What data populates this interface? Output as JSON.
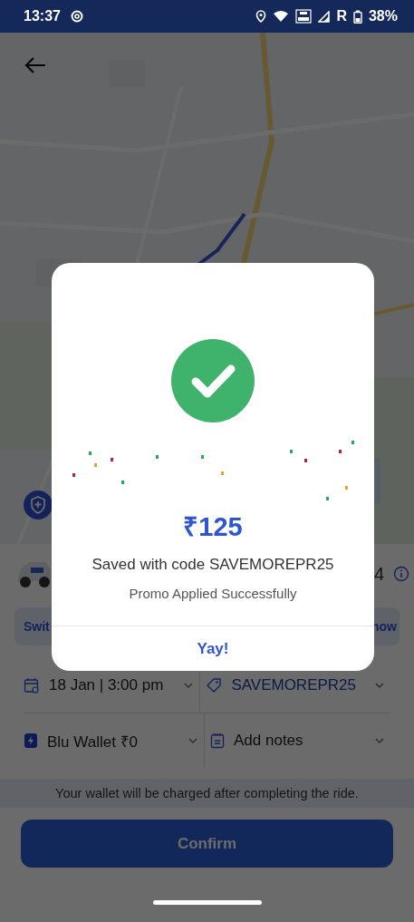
{
  "status_bar": {
    "time": "13:37",
    "network": "R",
    "battery": "38%"
  },
  "ride_option": {
    "trailing": "4"
  },
  "banner": {
    "left": "Swit",
    "right": "now"
  },
  "options": [
    {
      "kind": "schedule",
      "label": "18 Jan | 3:00 pm"
    },
    {
      "kind": "promo",
      "label": "SAVEMOREPR25"
    },
    {
      "kind": "wallet",
      "label": "Blu Wallet ₹0"
    },
    {
      "kind": "notes",
      "label": "Add notes"
    }
  ],
  "notice": "Your wallet will be charged after completing the ride.",
  "confirm_button": {
    "label": "Confirm"
  },
  "dialog": {
    "amount": "₹125",
    "message": "Saved with code SAVEMOREPR25",
    "subtitle": "Promo Applied Successfully",
    "button": "Yay!"
  }
}
